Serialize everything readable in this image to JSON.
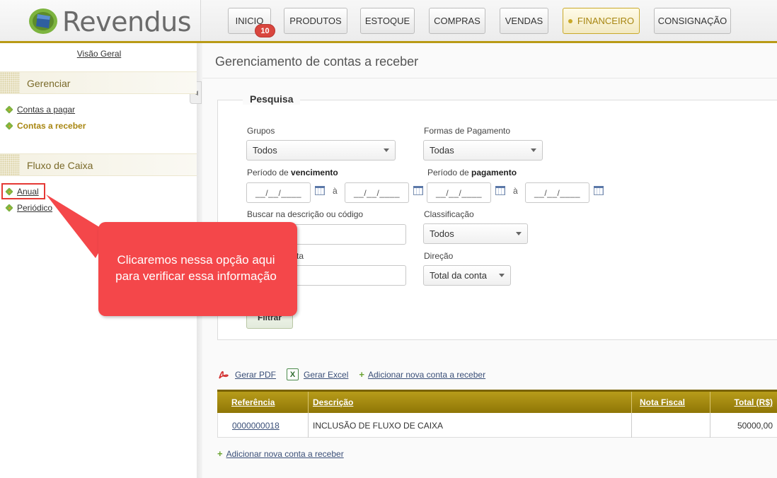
{
  "app": {
    "name": "Revendus",
    "colors": {
      "accent": "#b99a16",
      "callout": "#f4474a",
      "link": "#3a4f78",
      "badge": "#d9463e"
    }
  },
  "nav": {
    "items": [
      {
        "label": "INICIO",
        "badge": "10"
      },
      {
        "label": "PRODUTOS"
      },
      {
        "label": "ESTOQUE"
      },
      {
        "label": "COMPRAS"
      },
      {
        "label": "VENDAS"
      },
      {
        "label": "FINANCEIRO",
        "active": true
      },
      {
        "label": "CONSIGNAÇÃO"
      }
    ]
  },
  "sidebar": {
    "overview": "Visão Geral",
    "sections": [
      {
        "title": "Gerenciar",
        "links": [
          "Contas a pagar",
          "Contas a receber"
        ]
      },
      {
        "title": "Fluxo de Caixa",
        "links": [
          "Anual",
          "Periódico"
        ]
      }
    ]
  },
  "main": {
    "title": "Gerenciamento de contas a receber",
    "search": {
      "legend": "Pesquisa",
      "grupos_label": "Grupos",
      "grupos_value": "Todos",
      "formas_label": "Formas de Pagamento",
      "formas_value": "Todas",
      "venc_label_prefix": "Período de ",
      "venc_label_bold": "vencimento",
      "pag_label_prefix": "Período de ",
      "pag_label_bold": "pagamento",
      "date_placeholder": "__/__/____",
      "a_label": "à",
      "buscar_label": "Buscar na descrição ou código",
      "classificacao_label": "Classificação",
      "classificacao_value": "Todos",
      "ordenar_label_partial": "ta",
      "direcao_label": "Direção",
      "direcao_value": "Total da conta",
      "filter_button": "Filtrar"
    },
    "actions": {
      "pdf": "Gerar PDF",
      "excel": "Gerar Excel",
      "add": "Adicionar nova conta a receber"
    },
    "table": {
      "headers": [
        "Referência",
        "Descrição",
        "Nota Fiscal",
        "Total (R$)"
      ],
      "rows": [
        {
          "ref": "0000000018",
          "desc": "INCLUSÃO DE FLUXO DE CAIXA",
          "nf": "",
          "total": "50000,00"
        }
      ]
    },
    "bottom_add": "Adicionar nova conta a receber"
  },
  "callout": {
    "line1": "Clicaremos nessa opção aqui",
    "line2": "para verificar essa informação"
  }
}
